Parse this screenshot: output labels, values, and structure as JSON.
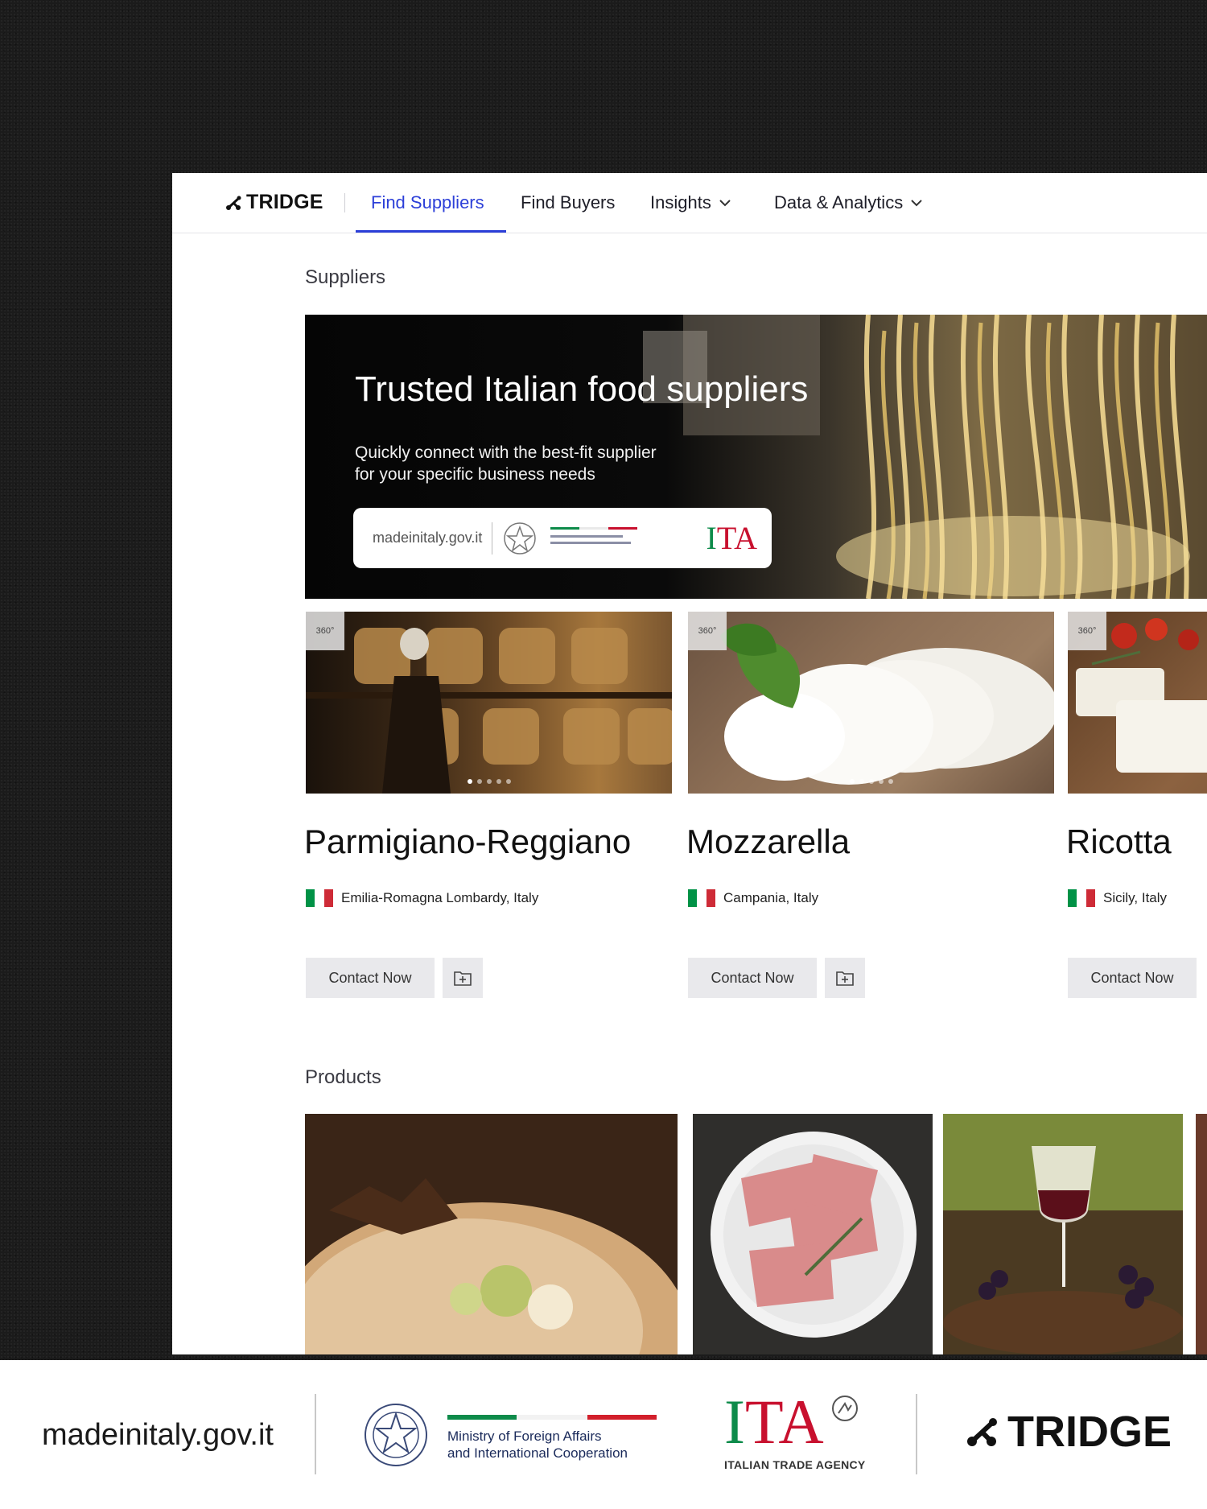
{
  "nav": {
    "logo": "TRIDGE",
    "items": [
      {
        "label": "Find Suppliers",
        "active": true
      },
      {
        "label": "Find Buyers"
      },
      {
        "label": "Insights",
        "dropdown": true
      },
      {
        "label": "Data & Analytics",
        "dropdown": true
      }
    ]
  },
  "suppliers_section": {
    "title": "Suppliers",
    "banner": {
      "title": "Trusted Italian food suppliers",
      "subtitle_line1": "Quickly connect with the best-fit supplier",
      "subtitle_line2": "for your specific business needs",
      "logo_site": "madeinitaly.gov.it",
      "logo_ita": "ITA"
    },
    "badge_360": "360°",
    "cards": [
      {
        "name": "Parmigiano-Reggiano",
        "location": "Emilia-Romagna Lombardy, Italy",
        "button": "Contact Now"
      },
      {
        "name": "Mozzarella",
        "location": "Campania, Italy",
        "button": "Contact Now"
      },
      {
        "name": "Ricotta",
        "location": "Sicily, Italy",
        "button": "Contact Now"
      }
    ]
  },
  "products_section": {
    "title": "Products"
  },
  "footer": {
    "site": "madeinitaly.gov.it",
    "ministry_line1": "Ministry of Foreign Affairs",
    "ministry_line2": "and International Cooperation",
    "ita": "ITA",
    "ita_sub": "ITALIAN TRADE AGENCY",
    "tridge": "TRIDGE"
  },
  "colors": {
    "accent": "#2c3fd8",
    "italy_green": "#009246",
    "italy_red": "#ce2b37"
  }
}
